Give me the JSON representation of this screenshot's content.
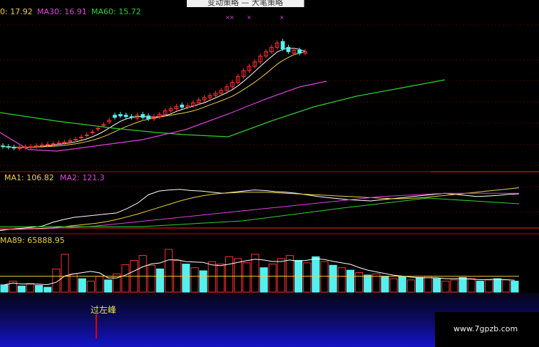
{
  "window": {
    "title_fragment": "变动策略 — 大笔策略"
  },
  "price_panel": {
    "legend": {
      "ma_first": "0: 17.92",
      "ma30": "MA30: 16.91",
      "ma60": "MA60: 15.72"
    }
  },
  "oscillator_panel": {
    "legend": {
      "ma1": "MA1: 106.82",
      "ma2": "MA2: 121.3"
    }
  },
  "volume_panel": {
    "legend": "MA89: 65888.95"
  },
  "signal": {
    "label": "过左峰"
  },
  "watermark": "www.7gpzb.com",
  "colors": {
    "up": "#ff3030",
    "down": "#54f0f0",
    "ma_short": "#ffffff",
    "ma_mid": "#f0d040",
    "ma30": "#e040e0",
    "ma60": "#30d030",
    "separator": "#c00000",
    "signal": "#f5e142",
    "marker": "#e040e0"
  },
  "chart_data": {
    "type": "candlestick",
    "bars": 60,
    "price": {
      "close": [
        12.1,
        12.05,
        12.0,
        12.02,
        12.08,
        12.1,
        12.15,
        12.2,
        12.25,
        12.3,
        12.35,
        12.4,
        12.5,
        12.6,
        12.75,
        12.9,
        13.1,
        13.35,
        13.6,
        13.9,
        14.1,
        14.2,
        14.15,
        14.1,
        14.25,
        14.1,
        14.0,
        14.15,
        14.3,
        14.55,
        14.7,
        14.85,
        14.8,
        14.9,
        15.1,
        15.3,
        15.45,
        15.6,
        15.75,
        15.95,
        16.2,
        16.5,
        16.9,
        17.3,
        17.6,
        17.9,
        18.3,
        18.6,
        18.9,
        19.2,
        18.8,
        18.6,
        18.7,
        18.5,
        18.6
      ],
      "open": [
        12.15,
        12.1,
        12.05,
        12.0,
        12.02,
        12.06,
        12.1,
        12.15,
        12.2,
        12.25,
        12.3,
        12.35,
        12.45,
        12.55,
        12.7,
        12.85,
        13.05,
        13.3,
        13.55,
        13.8,
        14.25,
        14.3,
        14.25,
        14.15,
        14.05,
        14.3,
        14.2,
        14.0,
        14.15,
        14.3,
        14.55,
        14.7,
        14.95,
        14.8,
        14.9,
        15.1,
        15.3,
        15.45,
        15.6,
        15.75,
        15.95,
        16.2,
        16.5,
        16.9,
        17.3,
        17.6,
        17.9,
        18.3,
        18.6,
        18.9,
        19.3,
        18.9,
        18.5,
        18.7,
        18.5
      ]
    },
    "ma_panel": {
      "ma1": [
        40,
        42,
        44,
        46,
        48,
        55,
        60,
        64,
        66,
        68,
        70,
        72,
        80,
        90,
        105,
        112,
        114,
        115,
        113,
        112,
        110,
        108,
        110,
        112,
        114,
        113,
        111,
        110,
        108,
        105,
        102,
        100,
        98,
        96,
        95,
        94,
        96,
        98,
        100,
        102,
        104,
        106,
        108,
        106,
        104,
        102,
        103,
        104,
        106,
        107
      ],
      "ma2": [
        42,
        42,
        43,
        43,
        44,
        45,
        47,
        49,
        51,
        53,
        56,
        60,
        65,
        70,
        76,
        82,
        88,
        94,
        99,
        103,
        106,
        108,
        109,
        110,
        110,
        110,
        109,
        108,
        107,
        106,
        105,
        104,
        103,
        102,
        101,
        100,
        99,
        98,
        98,
        99,
        100,
        102,
        104,
        106,
        108,
        110,
        112,
        114,
        116,
        118
      ],
      "ma3": [
        42,
        42,
        42,
        43,
        43,
        44,
        45,
        46,
        47,
        48,
        50,
        52,
        54,
        56,
        58,
        60,
        62,
        64,
        66,
        68,
        70,
        72,
        74,
        76,
        78,
        80,
        82,
        84,
        86,
        88,
        90,
        92,
        94,
        96,
        98,
        100,
        102,
        103,
        104,
        105,
        106,
        107,
        108,
        108,
        108,
        108,
        108,
        108,
        108,
        108
      ]
    },
    "volume": {
      "values": [
        12,
        18,
        10,
        14,
        11,
        8,
        38,
        62,
        30,
        22,
        18,
        26,
        20,
        30,
        45,
        52,
        60,
        44,
        38,
        70,
        52,
        46,
        40,
        35,
        50,
        46,
        58,
        55,
        48,
        62,
        40,
        46,
        55,
        60,
        52,
        48,
        58,
        50,
        44,
        40,
        36,
        32,
        28,
        30,
        26,
        22,
        25,
        20,
        24,
        26,
        22,
        18,
        20,
        24,
        22,
        18,
        20,
        22,
        20,
        18
      ],
      "up": [
        0,
        1,
        0,
        1,
        0,
        0,
        1,
        1,
        1,
        0,
        1,
        1,
        0,
        1,
        1,
        1,
        1,
        1,
        0,
        1,
        1,
        0,
        1,
        0,
        1,
        1,
        1,
        1,
        1,
        1,
        0,
        1,
        1,
        1,
        0,
        1,
        0,
        1,
        0,
        1,
        0,
        1,
        0,
        1,
        0,
        1,
        0,
        1,
        0,
        1,
        0,
        1,
        1,
        0,
        1,
        0,
        1,
        0,
        1,
        0
      ],
      "ma89": 26
    },
    "signal_bar_index": 14
  }
}
